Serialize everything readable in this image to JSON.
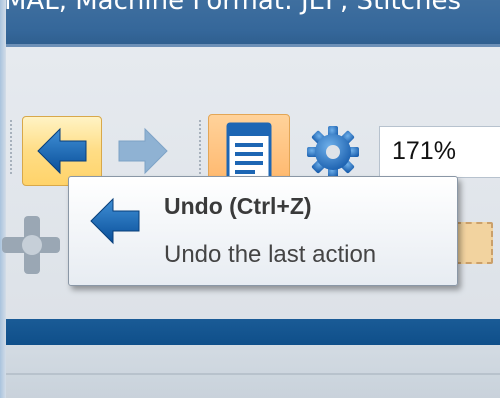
{
  "window": {
    "title_fragment": "MAL, Machine Format: JEF, Stitches"
  },
  "toolbar": {
    "undo_icon": "undo-arrow-left-icon",
    "redo_icon": "redo-arrow-right-icon",
    "document_icon": "document-properties-icon",
    "settings_icon": "gear-icon",
    "zoom_value": "171%"
  },
  "tooltip": {
    "icon": "undo-arrow-left-icon",
    "title": "Undo (Ctrl+Z)",
    "description": "Undo the last action"
  },
  "colors": {
    "accent_blue": "#0f4f8a",
    "hover_gold": "#ffd36a",
    "active_orange": "#ffb66a"
  }
}
